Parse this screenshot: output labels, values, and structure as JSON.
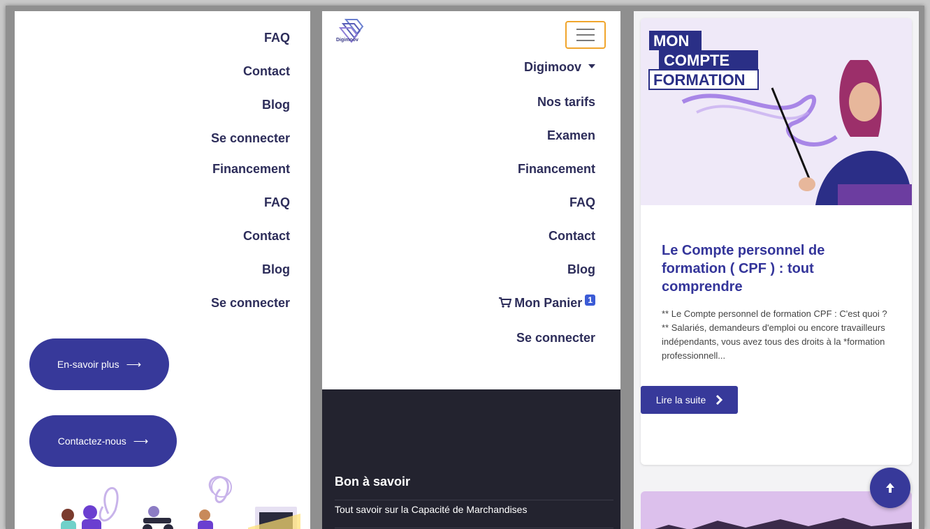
{
  "left_panel": {
    "nav": [
      "FAQ",
      "Contact",
      "Blog",
      "Se connecter",
      "Financement",
      "FAQ",
      "Contact",
      "Blog",
      "Se connecter"
    ],
    "learn_more_label": "En-savoir plus",
    "contact_label": "Contactez-nous",
    "arrow": "⟶"
  },
  "middle_panel": {
    "logo_text": "Digimoov",
    "nav": {
      "digimoov": "Digimoov",
      "tarifs": "Nos tarifs",
      "examen": "Examen",
      "financement": "Financement",
      "faq": "FAQ",
      "contact": "Contact",
      "blog": "Blog",
      "panier": "Mon Panier",
      "panier_count": "1",
      "connect": "Se connecter"
    },
    "footer": {
      "title": "Bon à savoir",
      "link": "Tout savoir sur la Capacité de Marchandises"
    }
  },
  "right_panel": {
    "banner": [
      "MON",
      "COMPTE",
      "FORMATION"
    ],
    "title": "Le Compte personnel de formation ( CPF ) : tout comprendre",
    "description": "** Le Compte personnel de formation CPF : C'est quoi ? ** Salariés, demandeurs d'emploi ou encore travailleurs indépendants, vous avez tous des droits à la *formation professionnell...",
    "read_more": "Lire la suite",
    "read_more_icon": "›"
  },
  "colors": {
    "brand": "#37399a",
    "nav_text": "#2d2d5a",
    "footer_bg": "#23232f",
    "hamburger_border": "#f0a52c",
    "badge": "#3b5bd6"
  },
  "icons": [
    "menu-icon",
    "caret-down-icon",
    "cart-icon",
    "arrow-right-icon",
    "chevron-right-icon",
    "arrow-up-icon"
  ]
}
